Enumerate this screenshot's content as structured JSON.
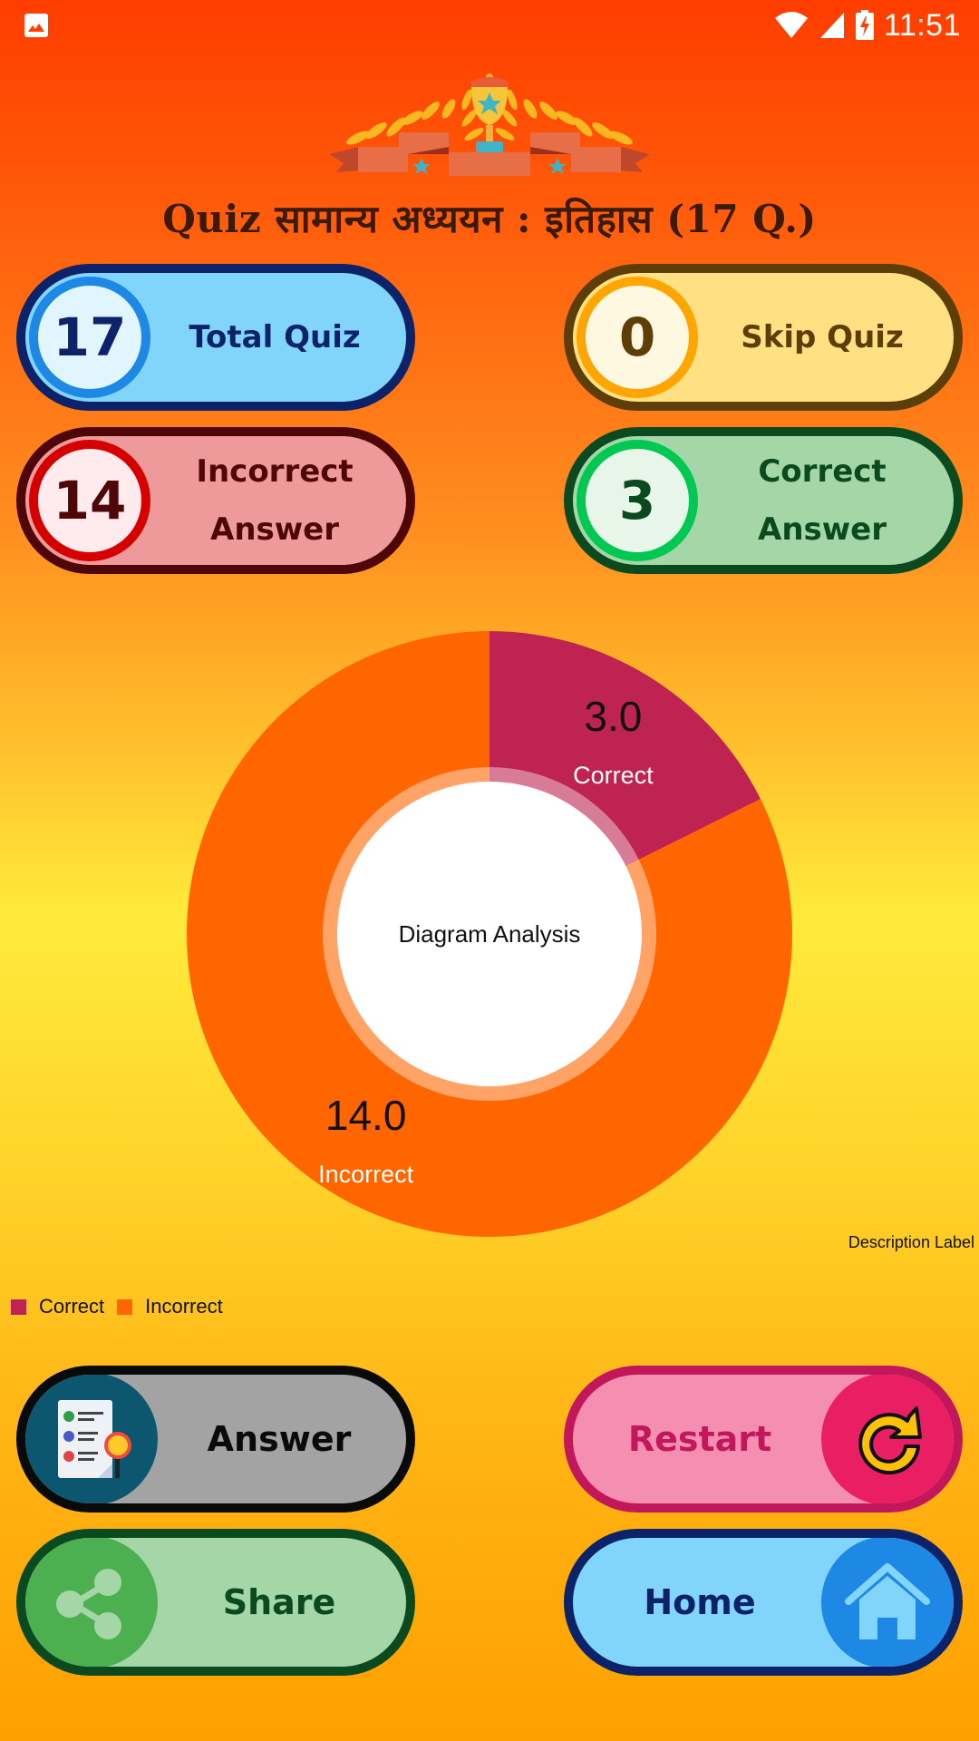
{
  "status_bar": {
    "time": "11:51",
    "left_icon": "image-notification-icon",
    "right_icons": [
      "wifi-icon",
      "cell-signal-icon",
      "battery-charging-icon"
    ]
  },
  "header": {
    "banner_icon": "trophy-banner-icon",
    "title": "Quiz सामान्य अध्ययन : इतिहास (17 Q.)"
  },
  "stats": {
    "total": {
      "value": "17",
      "label": "Total Quiz"
    },
    "skip": {
      "value": "0",
      "label": "Skip Quiz"
    },
    "incorrect": {
      "value": "14",
      "label_line1": "Incorrect",
      "label_line2": "Answer"
    },
    "correct": {
      "value": "3",
      "label_line1": "Correct",
      "label_line2": "Answer"
    }
  },
  "chart_data": {
    "type": "pie",
    "variant": "donut",
    "center_text": "Diagram Analysis",
    "description": "Description Label",
    "start_angle": "12 o'clock, clockwise",
    "slices": [
      {
        "label": "Correct",
        "value": 3.0,
        "value_text": "3.0",
        "color": "#BE2352"
      },
      {
        "label": "Incorrect",
        "value": 14.0,
        "value_text": "14.0",
        "color": "#FF6600"
      }
    ],
    "legend": {
      "position": "bottom-left",
      "entries": [
        {
          "label": "Correct",
          "color": "#BE2352"
        },
        {
          "label": "Incorrect",
          "color": "#FF6600"
        }
      ]
    }
  },
  "actions": {
    "answer": {
      "label": "Answer",
      "icon": "answer-sheet-icon"
    },
    "restart": {
      "label": "Restart",
      "icon": "restart-icon"
    },
    "share": {
      "label": "Share",
      "icon": "share-icon"
    },
    "home": {
      "label": "Home",
      "icon": "home-icon"
    }
  }
}
